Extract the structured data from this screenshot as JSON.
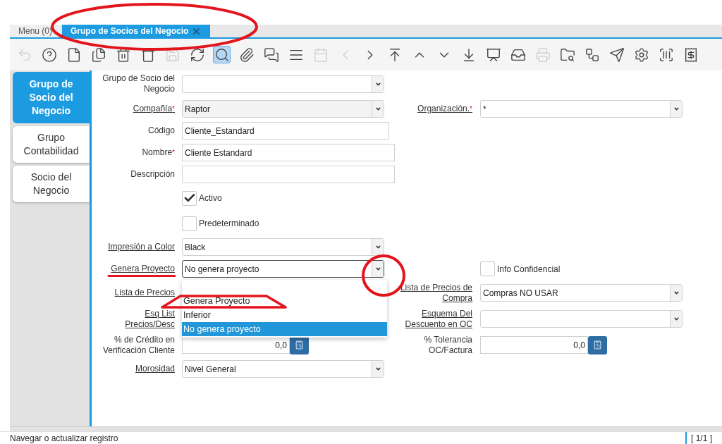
{
  "tabs": [
    {
      "label": "Menu (0)",
      "selected": false,
      "closable": false
    },
    {
      "label": "Grupo de Socios del Negocio",
      "selected": true,
      "closable": true
    }
  ],
  "toolbar": [
    {
      "kind": "undo",
      "disabled": true,
      "selected": false
    },
    {
      "kind": "help",
      "disabled": false,
      "selected": false
    },
    {
      "kind": "new",
      "disabled": false,
      "selected": false
    },
    {
      "kind": "copy",
      "disabled": false,
      "selected": false
    },
    {
      "kind": "delete",
      "disabled": false,
      "selected": false
    },
    {
      "kind": "delete-multi",
      "disabled": false,
      "selected": false
    },
    {
      "kind": "save",
      "disabled": true,
      "selected": false
    },
    {
      "kind": "refresh",
      "disabled": false,
      "selected": false
    },
    {
      "kind": "find",
      "disabled": false,
      "selected": true
    },
    {
      "kind": "attach",
      "disabled": false,
      "selected": false
    },
    {
      "kind": "chat",
      "disabled": false,
      "selected": false
    },
    {
      "kind": "grid",
      "disabled": false,
      "selected": false
    },
    {
      "kind": "calendar",
      "disabled": true,
      "selected": false
    },
    {
      "kind": "previous",
      "disabled": true,
      "selected": false
    },
    {
      "kind": "next",
      "disabled": false,
      "selected": false
    },
    {
      "kind": "first",
      "disabled": false,
      "selected": false
    },
    {
      "kind": "up",
      "disabled": false,
      "selected": false
    },
    {
      "kind": "down",
      "disabled": false,
      "selected": false
    },
    {
      "kind": "last",
      "disabled": false,
      "selected": false
    },
    {
      "kind": "report",
      "disabled": false,
      "selected": false
    },
    {
      "kind": "archive",
      "disabled": false,
      "selected": false
    },
    {
      "kind": "print",
      "disabled": true,
      "selected": false
    },
    {
      "kind": "zoom",
      "disabled": false,
      "selected": false
    },
    {
      "kind": "workflow",
      "disabled": false,
      "selected": false
    },
    {
      "kind": "send",
      "disabled": false,
      "selected": false
    },
    {
      "kind": "settings",
      "disabled": false,
      "selected": false
    },
    {
      "kind": "barcode",
      "disabled": false,
      "selected": false
    },
    {
      "kind": "receipt",
      "disabled": false,
      "selected": false
    }
  ],
  "side_tabs": [
    {
      "label": "Grupo de Socio del Negocio",
      "selected": true
    },
    {
      "label": "Grupo Contabilidad",
      "selected": false
    },
    {
      "label": "Socio del Negocio",
      "selected": false
    }
  ],
  "form": {
    "rows": [
      {
        "left": {
          "kind": "combo",
          "label": "Grupo de Socio del Negocio",
          "link": false,
          "required": false
        }
      },
      {
        "left": {
          "kind": "combo",
          "label": "Compañía",
          "link": true,
          "required": true,
          "value": "Raptor",
          "readonly": true
        },
        "right": {
          "kind": "combo",
          "label": "Organización.",
          "link": true,
          "required": true,
          "value": "*"
        }
      },
      {
        "left": {
          "kind": "text",
          "label": "Código",
          "link": false,
          "required": false,
          "value": "Cliente_Estandard"
        }
      },
      {
        "left": {
          "kind": "wide_text",
          "label": "Nombre",
          "link": false,
          "required": true,
          "value": "Cliente Estandard"
        }
      },
      {
        "left": {
          "kind": "wide_text",
          "label": "Descripción",
          "link": false,
          "required": false
        }
      },
      {
        "left": {
          "kind": "checkbox",
          "label": "Activo",
          "checked": true
        }
      },
      {
        "left": {
          "kind": "checkbox",
          "label": "Predeterminado",
          "checked": false
        }
      },
      {
        "left": {
          "kind": "combo",
          "label": "Impresión a Color",
          "link": true,
          "required": false,
          "value": "Black"
        }
      },
      {
        "left": {
          "kind": "combo",
          "label": "Genera Proyecto",
          "link": true,
          "required": false,
          "value": "No genera proyecto",
          "focused": true,
          "options": [
            {
              "label": "Genera Proyecto",
              "selected": false
            },
            {
              "label": "Inferior",
              "selected": false
            },
            {
              "label": "No genera proyecto",
              "selected": true
            }
          ]
        },
        "right": {
          "kind": "checkbox",
          "label": "Info Confidencial",
          "checked": false
        }
      },
      {
        "left": {
          "kind": "label",
          "label": "Lista de Precios",
          "link": true,
          "required": false
        },
        "right": {
          "kind": "combo",
          "label": "Lista de Precios de Compra",
          "link": true,
          "required": false,
          "value": "Compras NO USAR"
        }
      },
      {
        "left": {
          "kind": "label",
          "label": "Esq List Precios/Desc",
          "link": true,
          "required": false
        },
        "right": {
          "kind": "combo",
          "label": "Esquema Del Descuento en OC",
          "link": true,
          "required": false
        }
      },
      {
        "left": {
          "kind": "number",
          "label": "% de Crédito en Verificación Cliente",
          "link": false,
          "required": false,
          "value": "0,0"
        },
        "right": {
          "kind": "number",
          "label": "% Tolerancia OC/Factura",
          "link": false,
          "required": false,
          "value": "0,0"
        }
      },
      {
        "left": {
          "kind": "combo",
          "label": "Morosidad",
          "link": true,
          "required": false,
          "value": "Nivel General"
        }
      }
    ]
  },
  "annotations": [
    {
      "kind": "ellipse",
      "color": "#e3141c"
    },
    {
      "kind": "underline",
      "color": "#e3141c"
    },
    {
      "kind": "circle",
      "color": "#e3141c"
    },
    {
      "kind": "marker",
      "color": "#e3141c"
    }
  ],
  "status_bar": {
    "message": "Navegar o actualizar registro",
    "record": "[ 1/1 ]"
  }
}
